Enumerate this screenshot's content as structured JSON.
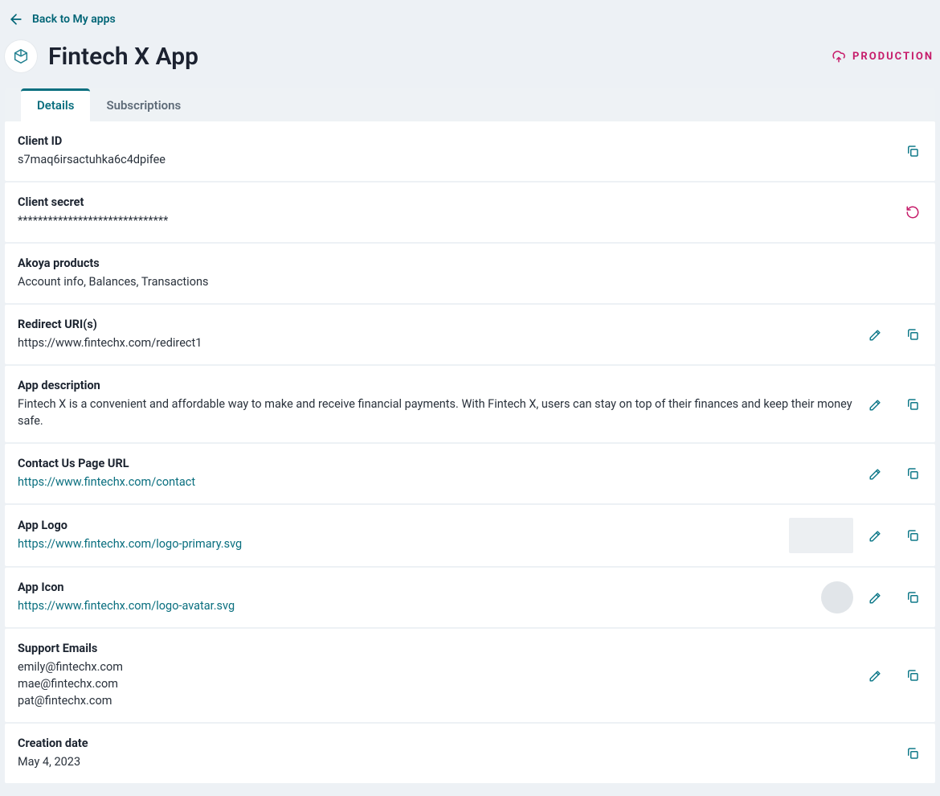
{
  "nav": {
    "back_label": "Back to My apps"
  },
  "header": {
    "app_title": "Fintech X App",
    "env_label": "PRODUCTION"
  },
  "tabs": {
    "details": "Details",
    "subscriptions": "Subscriptions",
    "active": "details"
  },
  "fields": {
    "client_id": {
      "label": "Client ID",
      "value": "s7maq6irsactuhka6c4dpifee"
    },
    "client_secret": {
      "label": "Client secret",
      "value": "******************************"
    },
    "products": {
      "label": "Akoya products",
      "value": "Account info, Balances, Transactions"
    },
    "redirect_uris": {
      "label": "Redirect URI(s)",
      "value": "https://www.fintechx.com/redirect1"
    },
    "description": {
      "label": "App description",
      "value": "Fintech X is a convenient and affordable way to make and receive financial payments. With Fintech X, users can stay on top of their finances and keep their money safe."
    },
    "contact_url": {
      "label": "Contact Us Page URL",
      "value": "https://www.fintechx.com/contact"
    },
    "app_logo": {
      "label": "App Logo",
      "value": "https://www.fintechx.com/logo-primary.svg"
    },
    "app_icon": {
      "label": "App Icon",
      "value": "https://www.fintechx.com/logo-avatar.svg"
    },
    "support_emails": {
      "label": "Support Emails",
      "values": [
        "emily@fintechx.com",
        "mae@fintechx.com",
        "pat@fintechx.com"
      ]
    },
    "creation_date": {
      "label": "Creation date",
      "value": "May 4, 2023"
    }
  },
  "icons": {
    "back": "arrow-left-icon",
    "app": "hexagon-icon",
    "env": "cloud-upload-icon",
    "copy": "copy-icon",
    "regenerate": "refresh-icon",
    "edit": "pencil-icon"
  },
  "colors": {
    "accent_teal": "#0a6f7f",
    "accent_pink": "#C61C6A",
    "page_bg": "#EDF1F5"
  }
}
